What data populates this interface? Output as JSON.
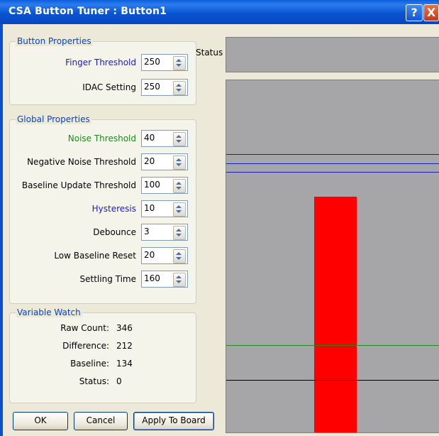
{
  "window": {
    "title": "CSA Button Tuner : Button1",
    "help_symbol": "?",
    "close_symbol": "X"
  },
  "button_properties": {
    "title": "Button Properties",
    "fields": [
      {
        "label": "Finger Threshold",
        "value": "250",
        "label_color": "#1a1ad0"
      },
      {
        "label": "IDAC Setting",
        "value": "250",
        "label_color": "#000000"
      }
    ]
  },
  "global_properties": {
    "title": "Global Properties",
    "fields": [
      {
        "label": "Noise Threshold",
        "value": "40",
        "label_color": "#1c8a1c"
      },
      {
        "label": "Negative Noise Threshold",
        "value": "20",
        "label_color": "#000000"
      },
      {
        "label": "Baseline Update Threshold",
        "value": "100",
        "label_color": "#000000"
      },
      {
        "label": "Hysteresis",
        "value": "10",
        "label_color": "#1a1ad0"
      },
      {
        "label": "Debounce",
        "value": "3",
        "label_color": "#000000"
      },
      {
        "label": "Low Baseline Reset",
        "value": "20",
        "label_color": "#000000"
      },
      {
        "label": "Settling Time",
        "value": "160",
        "label_color": "#000000"
      }
    ]
  },
  "variable_watch": {
    "title": "Variable Watch",
    "items": [
      {
        "label": "Raw Count:",
        "value": "346"
      },
      {
        "label": "Difference:",
        "value": "212"
      },
      {
        "label": "Baseline:",
        "value": "134"
      },
      {
        "label": "Status:",
        "value": "0"
      }
    ]
  },
  "buttons": {
    "ok": "OK",
    "cancel": "Cancel",
    "apply": "Apply To Board"
  },
  "status": {
    "label": "Status",
    "value": ""
  },
  "plot": {
    "colors": {
      "background": "#a6a5a8",
      "bar": "#fe0000",
      "threshold": "#1a1ad0",
      "noise": "#1c8a1c",
      "baseline": "#000000"
    }
  }
}
